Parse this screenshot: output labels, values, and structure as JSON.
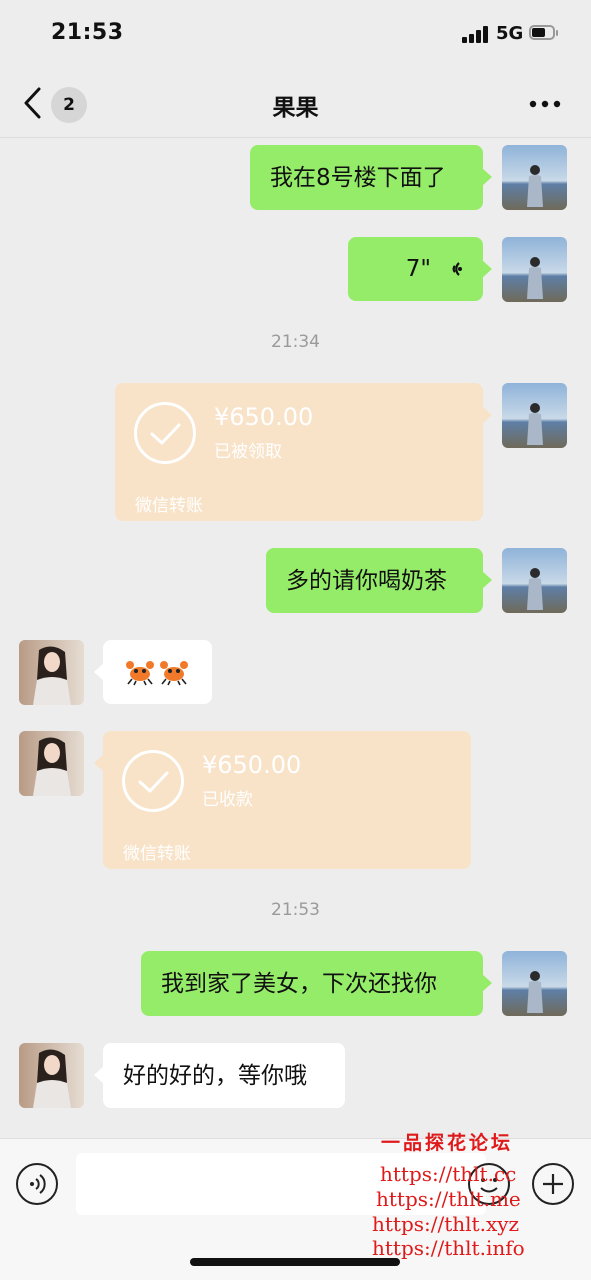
{
  "status_bar": {
    "time": "21:53",
    "network": "5G"
  },
  "header": {
    "unread_count": "2",
    "title": "果果"
  },
  "messages": [
    {
      "side": "right",
      "type": "text",
      "text": "我在8号楼下面了"
    },
    {
      "side": "right",
      "type": "voice",
      "duration": "7\""
    },
    {
      "type": "timestamp",
      "text": "21:34"
    },
    {
      "side": "right",
      "type": "transfer",
      "amount": "¥650.00",
      "status": "已被领取",
      "source": "微信转账"
    },
    {
      "side": "right",
      "type": "text",
      "text": "多的请你喝奶茶"
    },
    {
      "side": "left",
      "type": "emoji",
      "emoji": [
        "crab-sticker",
        "crab-sticker"
      ]
    },
    {
      "side": "left",
      "type": "transfer",
      "amount": "¥650.00",
      "status": "已收款",
      "source": "微信转账"
    },
    {
      "type": "timestamp",
      "text": "21:53"
    },
    {
      "side": "right",
      "type": "text",
      "text": "我到家了美女，下次还找你"
    },
    {
      "side": "left",
      "type": "text",
      "text": "好的好的，等你哦"
    }
  ],
  "watermark": {
    "title": "一品探花论坛",
    "links": [
      "https://thlt.cc",
      "https://thlt.me",
      "https://thlt.xyz",
      "https://thlt.info"
    ]
  },
  "colors": {
    "self_bubble": "#95ec69",
    "peer_bubble": "#ffffff",
    "transfer": "#f8e3c8",
    "background": "#ededed",
    "watermark": "#e01a1a"
  }
}
